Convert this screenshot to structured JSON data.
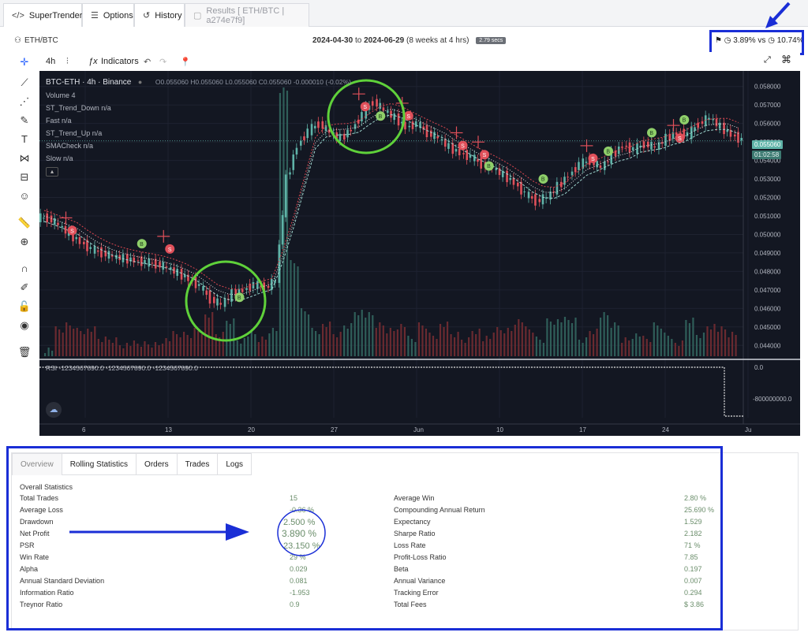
{
  "tabs": [
    {
      "label": "SuperTrender.cs",
      "icon": "code-icon"
    },
    {
      "label": "Options",
      "icon": "sliders-icon"
    },
    {
      "label": "History",
      "icon": "history-icon"
    },
    {
      "label": "Results [ ETH/BTC | a274e7f9]",
      "icon": "file-icon"
    }
  ],
  "header": {
    "pair": "ETH/BTC",
    "date_from": "2024-04-30",
    "to_word": "to",
    "date_to": "2024-06-29",
    "duration": "(8 weeks at 4 hrs)",
    "elapsed": "2.79 secs",
    "strategy_return": "3.89%",
    "vs_word": "vs",
    "benchmark_return": "10.74%"
  },
  "chart_toolbar": {
    "interval": "4h",
    "indicators_label": "Indicators"
  },
  "chart_legend": {
    "title": "BTC-ETH · 4h · Binance",
    "ohlc": "O0.055060 H0.055060 L0.055060 C0.055060 -0.000010 (-0.02%)",
    "indicators": [
      "Volume  4",
      "ST_Trend_Down  n/a",
      "Fast  n/a",
      "ST_Trend_Up  n/a",
      "SMACheck  n/a",
      "Slow  n/a"
    ],
    "rsi": "RSI  -1234567890.0  -1234567890.0  -1234567890.0"
  },
  "price_axis": {
    "labels": [
      "0.058000",
      "0.057000",
      "0.056000",
      "0.055000",
      "0.054000",
      "0.053000",
      "0.052000",
      "0.051000",
      "0.050000",
      "0.049000",
      "0.048000",
      "0.047000",
      "0.046000",
      "0.045000",
      "0.044000"
    ],
    "current_price": "0.055060",
    "countdown": "01:02:58",
    "rsi_labels": [
      "0.0",
      "-800000000.0"
    ]
  },
  "time_axis": {
    "labels": [
      "6",
      "13",
      "20",
      "27",
      "Jun",
      "10",
      "17",
      "24",
      "Ju"
    ]
  },
  "chart_data": {
    "type": "line",
    "series": [
      {
        "values": [
          0.0509,
          0.0505,
          0.05,
          0.0496,
          0.0492,
          0.049,
          0.0488,
          0.0487,
          0.0486,
          0.0485,
          0.0484,
          0.0482,
          0.0479,
          0.0476,
          0.0472,
          0.0465,
          0.0462,
          0.0468,
          0.047,
          0.0473,
          0.0471,
          0.0475,
          0.053,
          0.0548,
          0.0556,
          0.056,
          0.0555,
          0.0552,
          0.0557,
          0.0565,
          0.0572,
          0.0567,
          0.0563,
          0.0558,
          0.056,
          0.0555,
          0.0552,
          0.0547,
          0.0544,
          0.0542,
          0.0538,
          0.0536,
          0.0532,
          0.0528,
          0.0522,
          0.0518,
          0.052,
          0.0526,
          0.0532,
          0.0538,
          0.054,
          0.0536,
          0.0543,
          0.0548,
          0.0546,
          0.0549,
          0.0547,
          0.0552,
          0.0555,
          0.0554,
          0.056,
          0.0563,
          0.0558,
          0.0554,
          0.0551
        ]
      }
    ],
    "ylim": [
      0.0435,
      0.0585
    ],
    "buy_signals": [
      [
        0.0495,
        9
      ],
      [
        0.0466,
        18
      ],
      [
        0.0564,
        31
      ],
      [
        0.0537,
        41
      ],
      [
        0.053,
        46
      ],
      [
        0.0545,
        52
      ],
      [
        0.0555,
        56
      ],
      [
        0.0562,
        59
      ]
    ],
    "sell_signals": [
      [
        0.0503,
        2
      ],
      [
        0.0493,
        11
      ],
      [
        0.057,
        29
      ],
      [
        0.0565,
        33
      ],
      [
        0.0549,
        38
      ],
      [
        0.0544,
        40
      ],
      [
        0.0542,
        50
      ],
      [
        0.0553,
        58
      ]
    ]
  },
  "bottom_tabs": [
    "Overview",
    "Rolling Statistics",
    "Orders",
    "Trades",
    "Logs"
  ],
  "stats": {
    "heading": "Overall Statistics",
    "left": [
      {
        "label": "Total Trades",
        "value": "15"
      },
      {
        "label": "Average Loss",
        "value": "-0.36 %"
      },
      {
        "label": "Drawdown",
        "value": "2.500 %"
      },
      {
        "label": "Net Profit",
        "value": "3.890 %"
      },
      {
        "label": "PSR",
        "value": "23.150 %"
      },
      {
        "label": "Win Rate",
        "value": "29 %"
      },
      {
        "label": "Alpha",
        "value": "0.029"
      },
      {
        "label": "Annual Standard Deviation",
        "value": "0.081"
      },
      {
        "label": "Information Ratio",
        "value": "-1.953"
      },
      {
        "label": "Treynor Ratio",
        "value": "0.9"
      }
    ],
    "right": [
      {
        "label": "Average Win",
        "value": "2.80 %"
      },
      {
        "label": "Compounding Annual Return",
        "value": "25.690 %"
      },
      {
        "label": "Expectancy",
        "value": "1.529"
      },
      {
        "label": "Sharpe Ratio",
        "value": "2.182"
      },
      {
        "label": "Loss Rate",
        "value": "71 %"
      },
      {
        "label": "Profit-Loss Ratio",
        "value": "7.85"
      },
      {
        "label": "Beta",
        "value": "0.197"
      },
      {
        "label": "Annual Variance",
        "value": "0.007"
      },
      {
        "label": "Tracking Error",
        "value": "0.294"
      },
      {
        "label": "Total Fees",
        "value": "$ 3.86"
      }
    ]
  },
  "colors": {
    "chart_bg": "#131722",
    "up": "#5fb3a8",
    "down": "#e0505a",
    "buy_marker": "#8fcf6a",
    "sell_marker": "#e0505a",
    "annotation_blue": "#1a2ed6",
    "annotation_green": "#5fd13a"
  }
}
